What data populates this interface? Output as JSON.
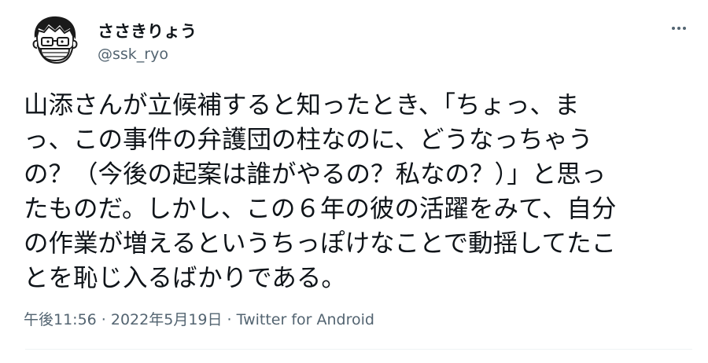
{
  "author": {
    "display_name": "ささきりょう",
    "handle": "@ssk_ryo",
    "avatar_icon": "cartoon-man-avatar-icon"
  },
  "menu_icon": "more-dots-icon",
  "tweet": {
    "lines": [
      "山添さんが立候補すると知ったとき、「ちょっ、ま",
      "っ、この事件の弁護団の柱なのに、どうなっちゃう",
      "の？（今後の起案は誰がやるの？私なの？）」と思っ",
      "たものだ。しかし、この６年の彼の活躍をみて、自分",
      "の作業が増えるというちっぽけなことで動揺してたこ",
      "とを恥じ入るばかりである。"
    ]
  },
  "meta": {
    "timestamp": "午後11:56 · 2022年5月19日",
    "separator": " · ",
    "source": "Twitter for Android"
  },
  "colors": {
    "text": "#0f1419",
    "secondary": "#536471",
    "divider": "#eff3f4"
  }
}
